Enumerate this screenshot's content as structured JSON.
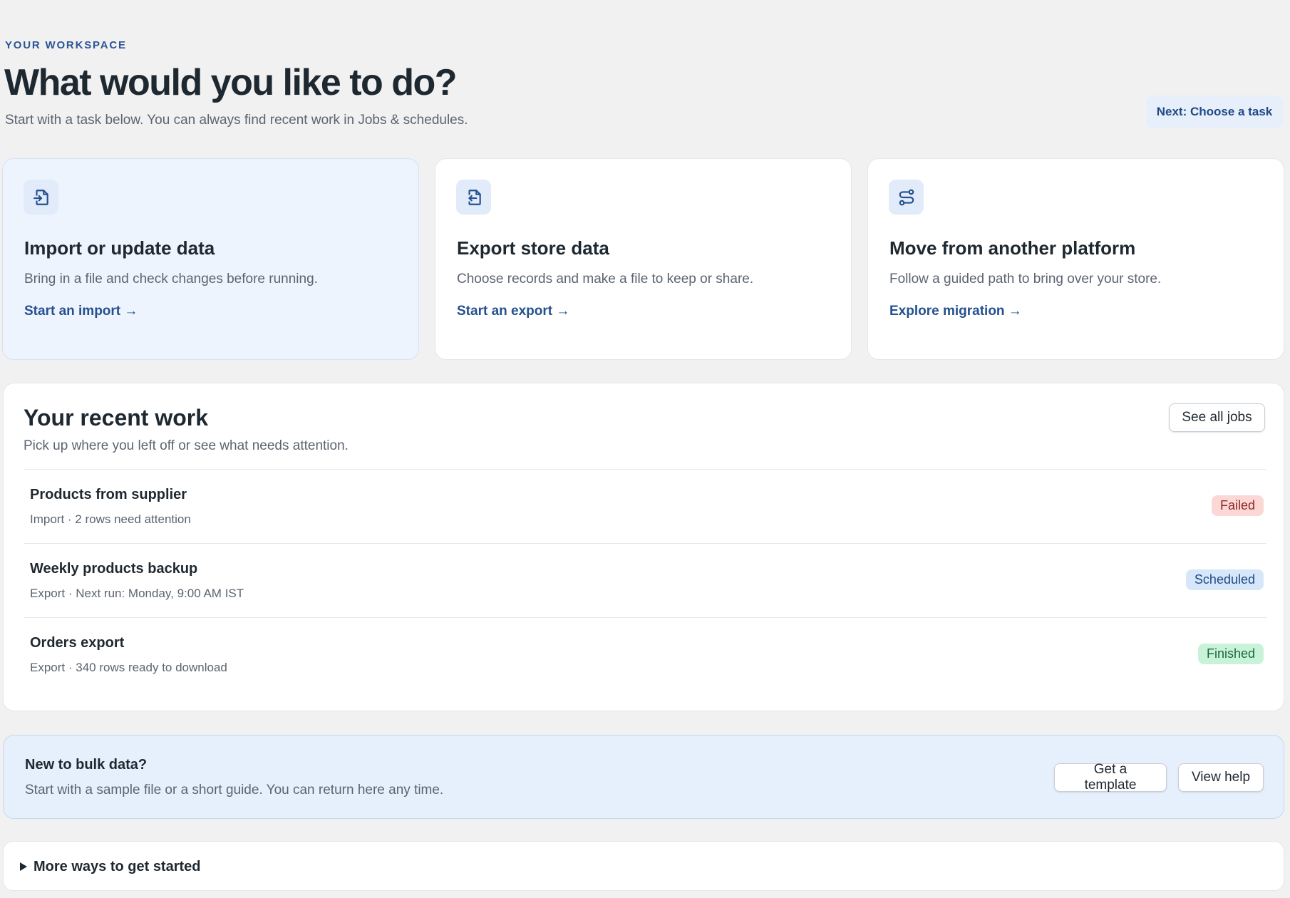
{
  "header": {
    "eyebrow": "YOUR WORKSPACE",
    "title": "What would you like to do?",
    "subtitle": "Start with a task below. You can always find recent work in Jobs & schedules.",
    "next_label": "Next: Choose a task"
  },
  "tasks": [
    {
      "icon": "file-import-icon",
      "title": "Import or update data",
      "description": "Bring in a file and check changes before running.",
      "link": "Start an import →"
    },
    {
      "icon": "file-export-icon",
      "title": "Export store data",
      "description": "Choose records and make a file to keep or share.",
      "link": "Start an export →"
    },
    {
      "icon": "route-icon",
      "title": "Move from another platform",
      "description": "Follow a guided path to bring over your store.",
      "link": "Explore migration →"
    }
  ],
  "recent": {
    "title": "Your recent work",
    "subtitle": "Pick up where you left off or see what needs attention.",
    "see_all_label": "See all jobs",
    "jobs": [
      {
        "title": "Products from supplier",
        "meta": "Import · 2 rows need attention",
        "status": "Failed",
        "status_color": "#fbd8d6"
      },
      {
        "title": "Weekly products backup",
        "meta": "Export · Next run: Monday, 9:00 AM IST",
        "status": "Scheduled",
        "status_color": "#d6e7fa"
      },
      {
        "title": "Orders export",
        "meta": "Export · 340 rows ready to download",
        "status": "Finished",
        "status_color": "#c9f3d9"
      }
    ]
  },
  "help": {
    "title": "New to bulk data?",
    "subtitle": "Start with a sample file or a short guide. You can return here any time.",
    "template_label": "Get a template",
    "view_help_label": "View help"
  },
  "more": {
    "label": "More ways to get started"
  },
  "colors": {
    "accent": "#24508f",
    "background": "#f1f1f1",
    "active_card": "#eef4fe"
  }
}
